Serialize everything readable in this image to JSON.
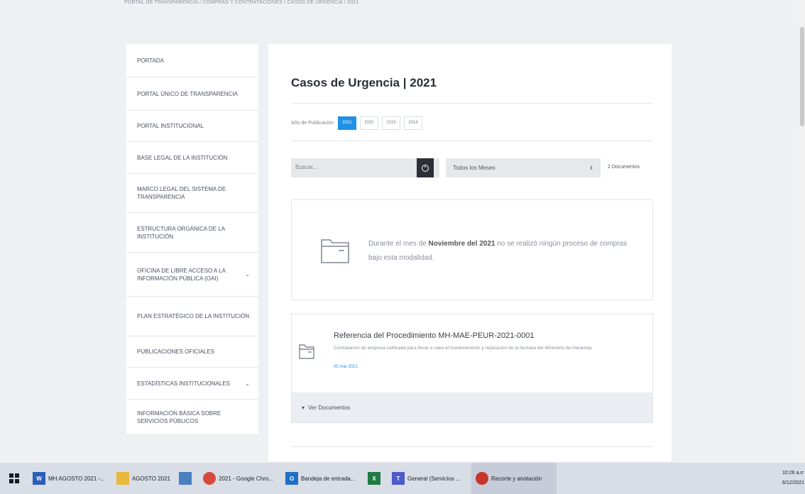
{
  "breadcrumb": "PORTAL DE TRANSPARENCIA / COMPRAS Y CONTRATACIONES / CASOS DE URGENCIA / 2021",
  "sidebar": {
    "items": [
      {
        "label": "PORTADA",
        "expandable": false
      },
      {
        "label": "PORTAL ÚNICO DE TRANSPARENCIA",
        "expandable": false
      },
      {
        "label": "PORTAL INSTITUCIONAL",
        "expandable": false
      },
      {
        "label": "BASE LEGAL DE LA INSTITUCIÓN",
        "expandable": false
      },
      {
        "label": "MARCO LEGAL DEL SISTEMA DE TRANSPARENCIA",
        "expandable": false
      },
      {
        "label": "ESTRUCTURA ORGÁNICA DE LA INSTITUCIÓN",
        "expandable": false
      },
      {
        "label": "OFICINA DE LIBRE ACCESO A LA INFORMACIÓN PÚBLICA (OAI)",
        "expandable": true
      },
      {
        "label": "PLAN ESTRATÉGICO DE LA INSTITUCIÓN",
        "expandable": false
      },
      {
        "label": "PUBLICACIONES OFICIALES",
        "expandable": false
      },
      {
        "label": "ESTADÍSTICAS INSTITUCIONALES",
        "expandable": true
      },
      {
        "label": "INFORMACIÓN BÁSICA SOBRE SERVICIOS PÚBLICOS",
        "expandable": false
      }
    ]
  },
  "main": {
    "title": "Casos de Urgencia | 2021",
    "year_filter": {
      "label": "Año de Publicación",
      "years": [
        "2021",
        "2020",
        "2019",
        "2018"
      ],
      "active": "2021"
    },
    "search": {
      "placeholder": "Buscar..."
    },
    "month_select": {
      "value": "Todos los Meses"
    },
    "doc_count": "2 Documentos",
    "empty_notice": {
      "prefix": "Durante el mes de ",
      "highlight": "Noviembre del 2021",
      "suffix": " no se realizó ningún proceso de compras bajo esta modalidad."
    },
    "procedure": {
      "title": "Referencia del Procedimiento MH-MAE-PEUR-2021-0001",
      "description": "Contratación de empresa calificada para llevar a cabo el mantenimiento y reparación de la fachada del Ministerio de Hacienda",
      "date": "05 mar 2021",
      "toggle_label": "Ver Documentos",
      "toggle_chevron": "▾"
    }
  },
  "taskbar": {
    "items": [
      {
        "label": "MH AGOSTO 2021 -...",
        "icon": "word-icon",
        "color": "#2b5eb8"
      },
      {
        "label": "AGOSTO 2021",
        "icon": "folder-icon",
        "color": "#e8b83c"
      },
      {
        "label": "",
        "icon": "notepad-icon",
        "color": "#4a7fc0"
      },
      {
        "label": "2021 - Google Chro...",
        "icon": "chrome-icon",
        "color": "#d64a3c"
      },
      {
        "label": "Bandeja de entrada...",
        "icon": "outlook-icon",
        "color": "#1f6fc4"
      },
      {
        "label": "",
        "icon": "excel-icon",
        "color": "#1f7a44"
      },
      {
        "label": "General (Servicios ...",
        "icon": "teams-icon",
        "color": "#5059c9"
      },
      {
        "label": "Recorte y anotación",
        "icon": "snip-icon",
        "color": "#c8342c"
      }
    ],
    "time": "10:26 a.m.",
    "date": "6/12/2021"
  },
  "colors": {
    "accent": "#1e90e6",
    "search_button": "#2c2f36"
  }
}
